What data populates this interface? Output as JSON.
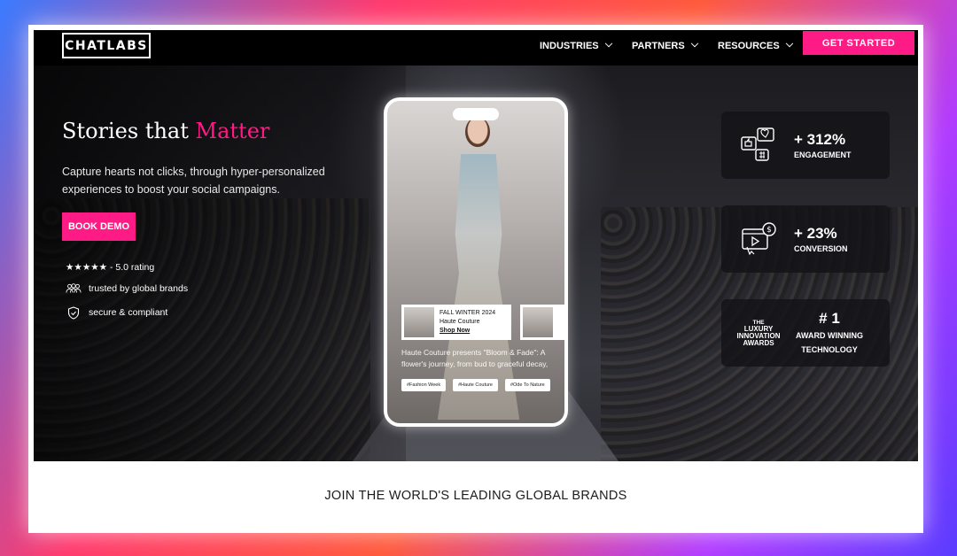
{
  "nav": {
    "logo": "CHATLABS",
    "items": [
      {
        "label": "INDUSTRIES"
      },
      {
        "label": "PARTNERS"
      },
      {
        "label": "RESOURCES"
      }
    ],
    "cta": "GET STARTED"
  },
  "hero": {
    "headline_start": "Stories that ",
    "headline_accent": "Matter",
    "subtitle": "Capture hearts not clicks, through hyper-personalized experiences to boost your social campaigns.",
    "book_demo": "BOOK DEMO",
    "trust": [
      {
        "icon": "star-icon",
        "label": "★★★★★ - 5.0 rating"
      },
      {
        "icon": "people-icon",
        "label": "trusted by global brands"
      },
      {
        "icon": "shield-icon",
        "label": "secure & compliant"
      }
    ]
  },
  "phone": {
    "product": {
      "line1": "FALL WINTER 2024",
      "line2": "Haute Couture",
      "link": "Shop Now"
    },
    "caption": "Haute Couture presents \"Bloom & Fade\": A flower's journey, from bud to graceful decay,",
    "tags": [
      "#Fashion Week",
      "#Haute Couture",
      "#Ode To Nature"
    ]
  },
  "stats": [
    {
      "icon": "social-engagement-icon",
      "value": "+ 312%",
      "label": "ENGAGEMENT"
    },
    {
      "icon": "video-dollar-icon",
      "value": "+ 23%",
      "label": "CONVERSION"
    }
  ],
  "award": {
    "badge_top": "THE",
    "badge_l1": "LUXURY",
    "badge_l2": "INNOVATION",
    "badge_l3": "AWARDS",
    "value": "# 1",
    "label1": "AWARD WINNING",
    "label2": "TECHNOLOGY"
  },
  "brands": {
    "title": "JOIN THE WORLD'S LEADING GLOBAL BRANDS"
  },
  "colors": {
    "accent": "#ff1b86",
    "hero_bg": "#000000"
  }
}
